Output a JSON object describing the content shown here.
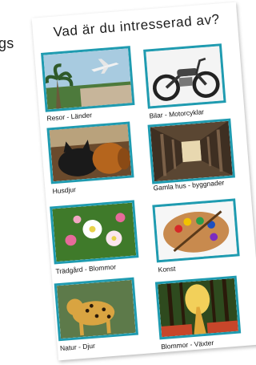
{
  "edge_text": "gs",
  "title": "Vad är du intresserad av?",
  "cards": [
    {
      "label": "Resor - Länder",
      "icon": "airplane-palm-photo"
    },
    {
      "label": "Bilar - Motorcyklar",
      "icon": "motorcycle-photo"
    },
    {
      "label": "Husdjur",
      "icon": "cat-dog-photo"
    },
    {
      "label": "Gamla hus - byggnader",
      "icon": "old-building-interior-photo"
    },
    {
      "label": "Trädgård - Blommor",
      "icon": "apple-blossom-photo"
    },
    {
      "label": "Konst",
      "icon": "paint-palette-photo"
    },
    {
      "label": "Natur - Djur",
      "icon": "leopard-photo"
    },
    {
      "label": "Blommor - Växter",
      "icon": "forest-path-photo"
    }
  ],
  "colors": {
    "frame": "#1f9bb0",
    "background": "#ffffff"
  }
}
